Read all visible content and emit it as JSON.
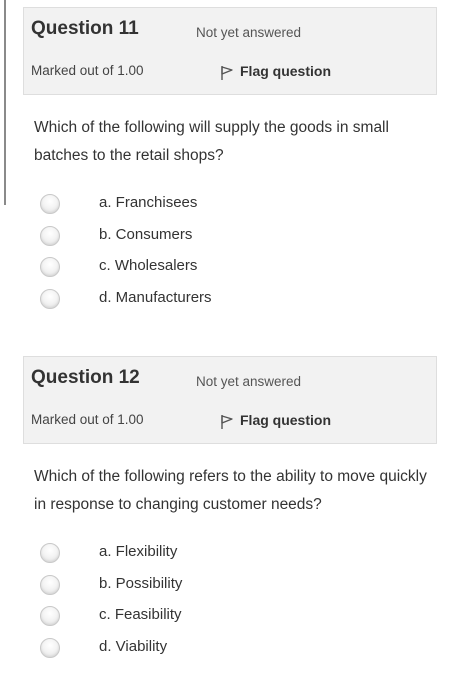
{
  "questions": [
    {
      "title": "Question 11",
      "state": "Not yet answered",
      "grade": "Marked out of 1.00",
      "flag_label": "Flag question",
      "flag_icon": "flag-icon",
      "text": "Which of the following will supply the goods in small batches to the retail shops?",
      "answers": [
        {
          "label": "a. Franchisees",
          "selected": false
        },
        {
          "label": "b. Consumers",
          "selected": false
        },
        {
          "label": "c. Wholesalers",
          "selected": false
        },
        {
          "label": "d. Manufacturers",
          "selected": false
        }
      ]
    },
    {
      "title": "Question 12",
      "state": "Not yet answered",
      "grade": "Marked out of 1.00",
      "flag_label": "Flag question",
      "flag_icon": "flag-icon",
      "text": "Which of the following refers to the ability to move quickly in response to changing customer needs?",
      "answers": [
        {
          "label": "a. Flexibility",
          "selected": false
        },
        {
          "label": "b. Possibility",
          "selected": false
        },
        {
          "label": "c. Feasibility",
          "selected": false
        },
        {
          "label": "d. Viability",
          "selected": false
        }
      ]
    }
  ],
  "colors": {
    "info_box_bg": "#f2f2f2",
    "info_box_border": "#dedede",
    "text": "#333333"
  }
}
